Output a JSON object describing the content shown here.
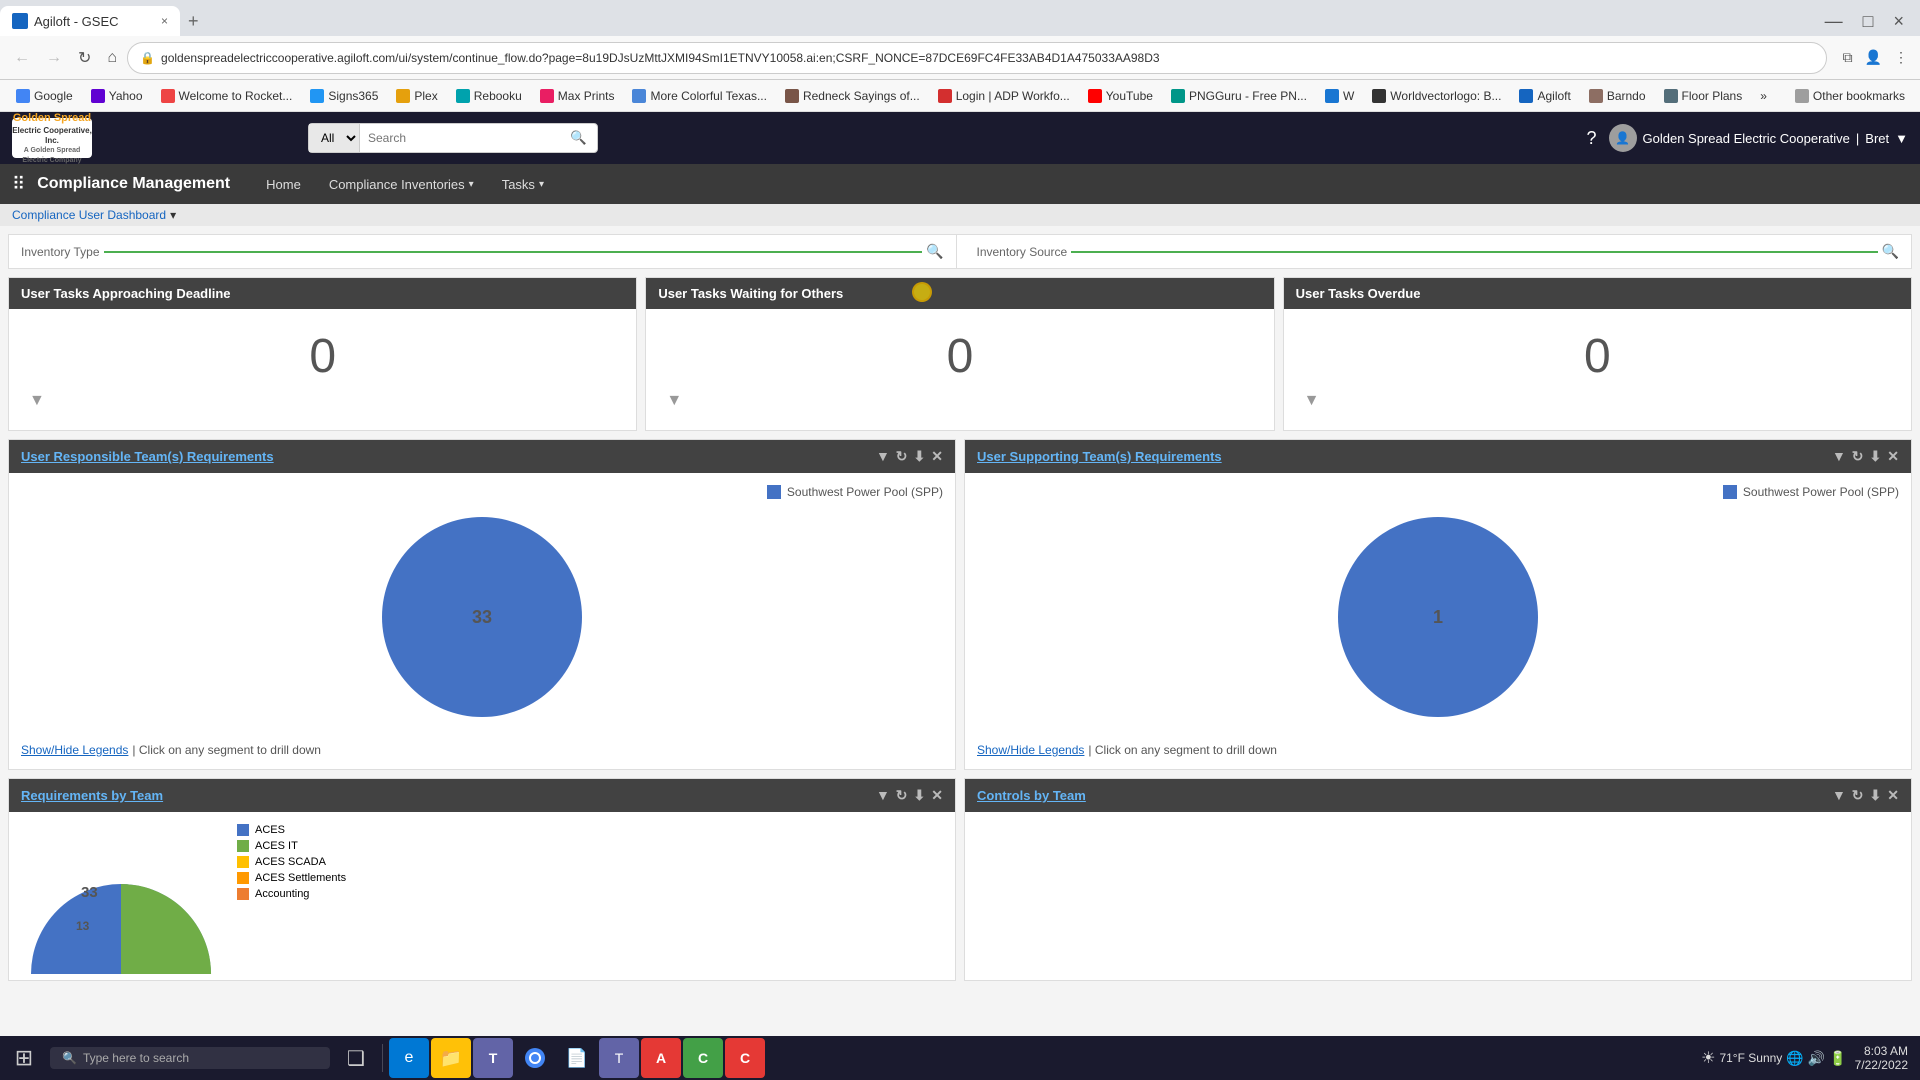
{
  "browser": {
    "tab": {
      "favicon_label": "A",
      "title": "Agiloft - GSEC",
      "close_btn": "×",
      "new_tab_btn": "+"
    },
    "window_controls": {
      "minimize": "—",
      "maximize": "□",
      "close": "×"
    },
    "nav": {
      "back": "←",
      "forward": "→",
      "refresh": "↻",
      "home": "⌂",
      "url": "goldenspreadelectriccooperative.agiloft.com/ui/system/continue_flow.do?page=8u19DJsUzMttJXMI94SmI1ETNVY10058.ai:en;CSRF_NONCE=87DCE69FC4FE33AB4D1A475033AA98D3",
      "lock_icon": "🔒",
      "extensions_btn": "⧉",
      "profile_btn": "👤",
      "settings_btn": "⋮"
    },
    "bookmarks": [
      {
        "id": "google",
        "label": "Google",
        "cls": "bm-google"
      },
      {
        "id": "yahoo",
        "label": "Yahoo",
        "cls": "bm-yahoo"
      },
      {
        "id": "rocket",
        "label": "Welcome to Rocket...",
        "cls": "bm-rocket"
      },
      {
        "id": "signs",
        "label": "Signs365",
        "cls": "bm-signs"
      },
      {
        "id": "plex",
        "label": "Plex",
        "cls": "bm-plex"
      },
      {
        "id": "rebook",
        "label": "Rebooku",
        "cls": "bm-rebook"
      },
      {
        "id": "maxprints",
        "label": "Max Prints",
        "cls": "bm-maxprints"
      },
      {
        "id": "more-colorful",
        "label": "More Colorful Texas...",
        "cls": "bm-more"
      },
      {
        "id": "redneck",
        "label": "Redneck Sayings of...",
        "cls": "bm-redneck"
      },
      {
        "id": "adp",
        "label": "Login | ADP Workfo...",
        "cls": "bm-adp"
      },
      {
        "id": "youtube",
        "label": "YouTube",
        "cls": "bm-youtube"
      },
      {
        "id": "png",
        "label": "PNGGuru - Free PN...",
        "cls": "bm-png"
      },
      {
        "id": "word",
        "label": "W",
        "cls": "bm-word"
      },
      {
        "id": "worldvec",
        "label": "Worldvectorlogo: B...",
        "cls": "bm-worldvec"
      },
      {
        "id": "agiloft",
        "label": "Agiloft",
        "cls": "bm-agiloft"
      },
      {
        "id": "barndo",
        "label": "Barndo",
        "cls": "bm-barndo"
      },
      {
        "id": "floor",
        "label": "Floor Plans",
        "cls": "bm-floor"
      },
      {
        "id": "more-arrow",
        "label": "»",
        "cls": "bm-more-arrow"
      }
    ]
  },
  "app": {
    "logo": {
      "company": "Golden Spread",
      "subtitle": "Electric Cooperative, Inc.",
      "tagline": "A Golden Spread Electric Company"
    },
    "search": {
      "type_option": "All",
      "placeholder": "Search",
      "button_label": "🔍"
    },
    "header_right": {
      "company_name": "Golden Spread Electric Cooperative",
      "help_icon": "?",
      "user_name": "Bret",
      "user_icon": "▼"
    },
    "nav": {
      "grid_icon": "⠿",
      "title": "Compliance Management",
      "items": [
        {
          "id": "home",
          "label": "Home",
          "has_dropdown": false
        },
        {
          "id": "compliance-inventories",
          "label": "Compliance Inventories",
          "has_dropdown": true
        },
        {
          "id": "tasks",
          "label": "Tasks",
          "has_dropdown": true
        }
      ]
    },
    "breadcrumb": {
      "link": "Compliance User Dashboard",
      "dropdown_icon": "▾"
    },
    "filters": {
      "inventory_type": {
        "label": "Inventory Type",
        "value": "",
        "search_icon": "🔍"
      },
      "inventory_source": {
        "label": "Inventory Source",
        "value": "",
        "search_icon": "🔍"
      }
    },
    "stat_cards": [
      {
        "id": "approaching-deadline",
        "title": "User Tasks Approaching Deadline",
        "value": "0",
        "filter_icon": "▼"
      },
      {
        "id": "waiting-others",
        "title": "User Tasks Waiting for Others",
        "value": "0",
        "filter_icon": "▼"
      },
      {
        "id": "overdue",
        "title": "User Tasks Overdue",
        "value": "0",
        "filter_icon": "▼"
      }
    ],
    "chart_cards": [
      {
        "id": "responsible-requirements",
        "title": "User Responsible Team(s) Requirements",
        "legend_color": "#4472c4",
        "legend_label": "Southwest Power Pool (SPP)",
        "pie_value": "33",
        "pie_color": "#4472c4",
        "show_legends": "Show/Hide Legends",
        "drill_down": "| Click on any segment to drill down",
        "filter_icon": "▼",
        "refresh_icon": "↻",
        "export_icon": "⬇",
        "close_icon": "✕"
      },
      {
        "id": "supporting-requirements",
        "title": "User Supporting Team(s) Requirements",
        "legend_color": "#4472c4",
        "legend_label": "Southwest Power Pool (SPP)",
        "pie_value": "1",
        "pie_color": "#4472c4",
        "show_legends": "Show/Hide Legends",
        "drill_down": "| Click on any segment to drill down",
        "filter_icon": "▼",
        "refresh_icon": "↻",
        "export_icon": "⬇",
        "close_icon": "✕"
      }
    ],
    "bottom_charts": [
      {
        "id": "requirements-by-team",
        "title": "Requirements by Team",
        "pie_main_value": "33",
        "pie_sub_value": "13",
        "legend_items": [
          {
            "label": "ACES",
            "color": "#4472c4"
          },
          {
            "label": "ACES IT",
            "color": "#70ad47"
          },
          {
            "label": "ACES SCADA",
            "color": "#ffc000"
          },
          {
            "label": "ACES Settlements",
            "color": "#ff9900"
          },
          {
            "label": "Accounting",
            "color": "#ed7d31"
          }
        ]
      },
      {
        "id": "controls-by-team",
        "title": "Controls by Team",
        "legend_items": []
      }
    ]
  },
  "taskbar": {
    "start_icon": "⊞",
    "search_placeholder": "Type here to search",
    "search_icon": "🔍",
    "apps": [
      {
        "id": "task-view",
        "icon": "❑"
      },
      {
        "id": "edge",
        "icon": "🌐"
      },
      {
        "id": "explorer",
        "icon": "📁"
      },
      {
        "id": "teams",
        "icon": "T"
      },
      {
        "id": "chrome",
        "icon": "⬤"
      },
      {
        "id": "files",
        "icon": "📄"
      },
      {
        "id": "ms-teams2",
        "icon": "T"
      },
      {
        "id": "acrobat",
        "icon": "A"
      },
      {
        "id": "app8",
        "icon": "C"
      }
    ],
    "system_tray": {
      "weather": "71°F Sunny",
      "time": "8:03 AM",
      "date": "7/22/2022",
      "icons": [
        "🔊",
        "🌐",
        "🔋"
      ]
    }
  }
}
